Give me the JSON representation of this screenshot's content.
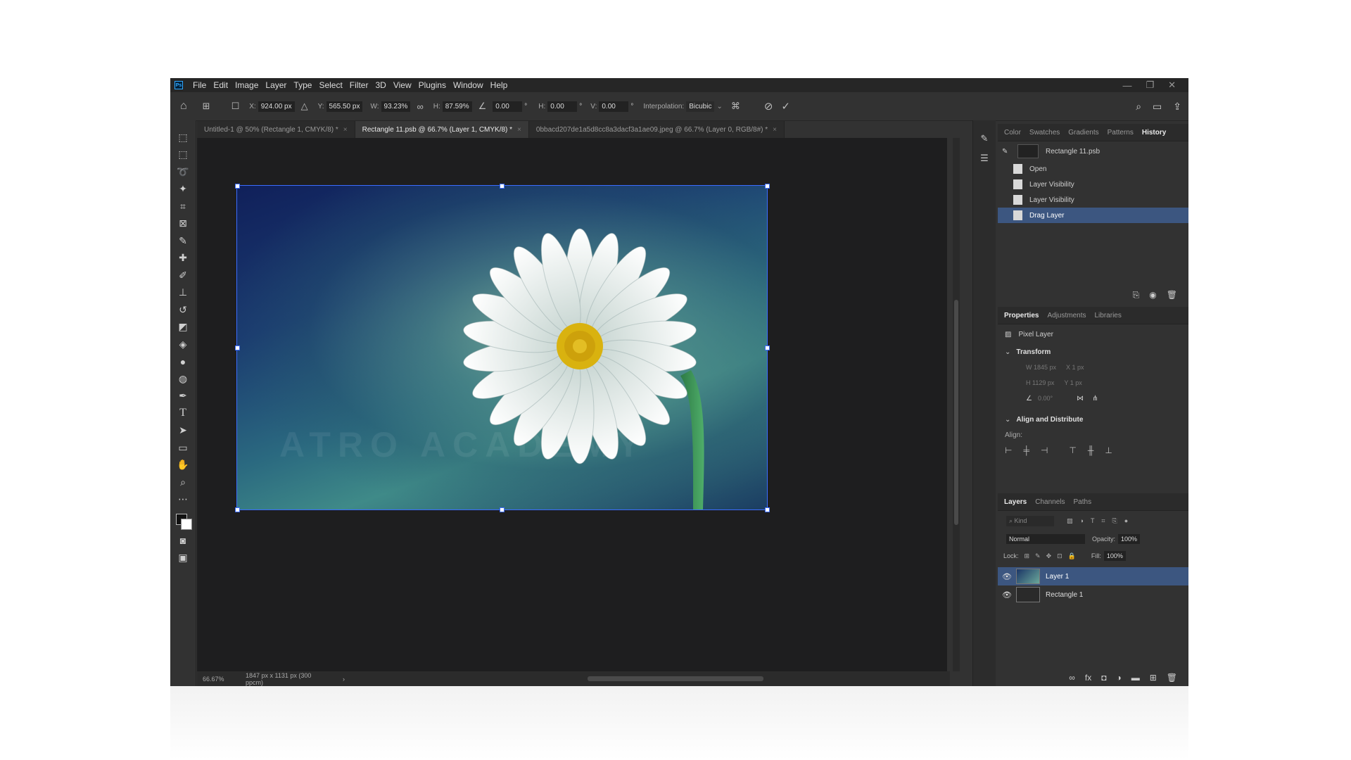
{
  "menu": {
    "items": [
      "File",
      "Edit",
      "Image",
      "Layer",
      "Type",
      "Select",
      "Filter",
      "3D",
      "View",
      "Plugins",
      "Window",
      "Help"
    ]
  },
  "window_controls": {
    "minimize": "—",
    "restore": "❐",
    "close": "✕"
  },
  "options_bar": {
    "x_label": "X:",
    "x_value": "924.00 px",
    "y_label": "Y:",
    "y_value": "565.50 px",
    "w_label": "W:",
    "w_value": "93.23%",
    "h_label": "H:",
    "h_value": "87.59%",
    "angle_value": "0.00",
    "hskew_label": "H:",
    "hskew_value": "0.00",
    "vskew_label": "V:",
    "vskew_value": "0.00",
    "degree": "°",
    "interp_label": "Interpolation:",
    "interp_value": "Bicubic"
  },
  "tabs": [
    {
      "label": "Untitled-1 @ 50% (Rectangle 1, CMYK/8) *"
    },
    {
      "label": "Rectangle 11.psb @ 66.7% (Layer 1, CMYK/8) *"
    },
    {
      "label": "0bbacd207de1a5d8cc8a3dacf3a1ae09.jpeg @ 66.7% (Layer 0, RGB/8#) *"
    }
  ],
  "status": {
    "zoom": "66.67%",
    "doc_info": "1847 px x 1131 px (300 ppcm)"
  },
  "history_panel": {
    "tabs": [
      "Color",
      "Swatches",
      "Gradients",
      "Patterns",
      "History"
    ],
    "snapshot": "Rectangle 11.psb",
    "states": [
      "Open",
      "Layer Visibility",
      "Layer Visibility",
      "Drag Layer"
    ]
  },
  "properties_panel": {
    "tabs": [
      "Properties",
      "Adjustments",
      "Libraries"
    ],
    "type": "Pixel Layer",
    "transform_title": "Transform",
    "w": "W 1845 px",
    "x": "X 1 px",
    "h": "H 1129 px",
    "y": "Y 1 px",
    "angle": "0.00°",
    "align_title": "Align and Distribute",
    "align_label": "Align:"
  },
  "layers_panel": {
    "tabs": [
      "Layers",
      "Channels",
      "Paths"
    ],
    "kind": "Kind",
    "blend_mode": "Normal",
    "opacity_label": "Opacity:",
    "opacity_value": "100%",
    "lock_label": "Lock:",
    "fill_label": "Fill:",
    "fill_value": "100%",
    "layers": [
      {
        "name": "Layer 1"
      },
      {
        "name": "Rectangle 1"
      }
    ]
  },
  "watermark": "ATRO ACADEMY",
  "colors": {
    "selection": "#3c5680",
    "transform_outline": "#3b6cff",
    "flower_center": "#d9b20f"
  }
}
